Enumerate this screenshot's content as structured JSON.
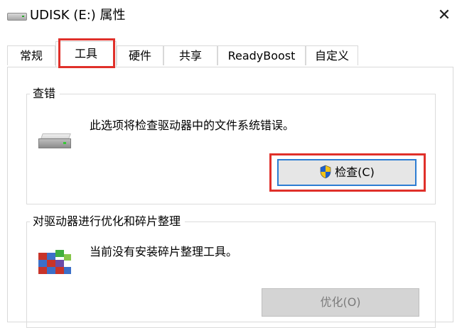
{
  "window": {
    "title": "UDISK (E:) 属性",
    "close_symbol": "✕"
  },
  "tabs": [
    {
      "label": "常规",
      "active": false
    },
    {
      "label": "工具",
      "active": true
    },
    {
      "label": "硬件",
      "active": false
    },
    {
      "label": "共享",
      "active": false
    },
    {
      "label": "ReadyBoost",
      "active": false
    },
    {
      "label": "自定义",
      "active": false
    }
  ],
  "error_check": {
    "title": "查错",
    "description": "此选项将检查驱动器中的文件系统错误。",
    "button_label": "检查(C)"
  },
  "optimize": {
    "title": "对驱动器进行优化和碎片整理",
    "description": "当前没有安装碎片整理工具。",
    "button_label": "优化(O)"
  },
  "colors": {
    "highlight": "#e0302a",
    "focus_border": "#2d7dd2"
  }
}
